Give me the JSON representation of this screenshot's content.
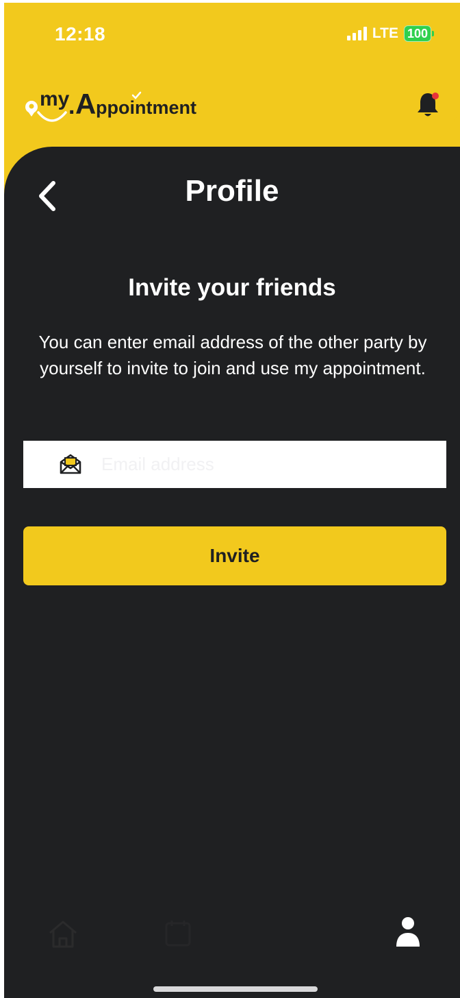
{
  "status_bar": {
    "time": "12:18",
    "network": "LTE",
    "battery": "100"
  },
  "header": {
    "logo_text": "myAppointment",
    "notification_icon": "bell-icon",
    "has_unread_notifications": true
  },
  "nav": {
    "back_icon": "chevron-left-icon",
    "title": "Profile"
  },
  "invite": {
    "heading": "Invite your friends",
    "description": "You can enter email address of the other party by yourself to invite to join and use my appointment.",
    "email_icon": "envelope-icon",
    "email_placeholder": "Email address",
    "email_value": "",
    "button_label": "Invite"
  },
  "bottom_nav": {
    "items": [
      {
        "icon": "home-icon",
        "active": false
      },
      {
        "icon": "calendar-icon",
        "active": false
      },
      {
        "icon": "profile-icon",
        "active": true
      }
    ]
  },
  "colors": {
    "brand_yellow": "#f2c91d",
    "background_dark": "#1f2022",
    "text_light": "#ffffff",
    "notification_dot": "#e8343a",
    "battery_green": "#2fd04e"
  }
}
